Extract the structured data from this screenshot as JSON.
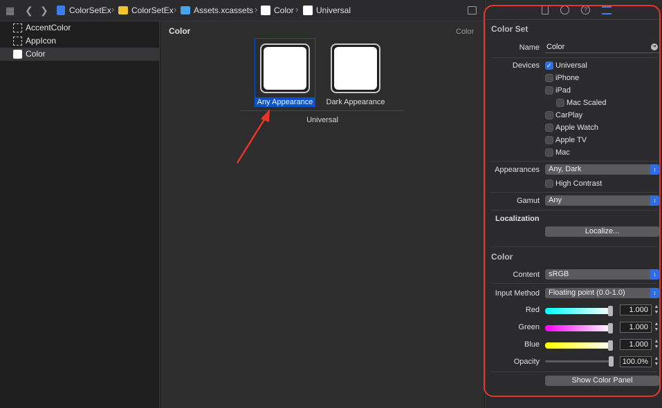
{
  "breadcrumb": {
    "items": [
      "ColorSetEx",
      "ColorSetEx",
      "Assets.xcassets",
      "Color",
      "Universal"
    ]
  },
  "navigator": {
    "items": [
      {
        "label": "AccentColor",
        "selected": false
      },
      {
        "label": "AppIcon",
        "selected": false
      },
      {
        "label": "Color",
        "selected": true
      }
    ]
  },
  "editor": {
    "title": "Color",
    "right_label": "Color",
    "wells": [
      {
        "label": "Any Appearance",
        "selected": true
      },
      {
        "label": "Dark Appearance",
        "selected": false
      }
    ],
    "group_label": "Universal"
  },
  "inspector": {
    "tab_icons": [
      "file-icon",
      "history-icon",
      "help-icon",
      "attributes-icon"
    ],
    "color_set_title": "Color Set",
    "name_label": "Name",
    "name_value": "Color",
    "devices_label": "Devices",
    "devices": [
      {
        "label": "Universal",
        "checked": true
      },
      {
        "label": "iPhone",
        "checked": false
      },
      {
        "label": "iPad",
        "checked": false
      },
      {
        "label": "Mac Scaled",
        "checked": false
      },
      {
        "label": "CarPlay",
        "checked": false
      },
      {
        "label": "Apple Watch",
        "checked": false
      },
      {
        "label": "Apple TV",
        "checked": false
      },
      {
        "label": "Mac",
        "checked": false
      }
    ],
    "appearances_label": "Appearances",
    "appearances_value": "Any, Dark",
    "high_contrast_label": "High Contrast",
    "gamut_label": "Gamut",
    "gamut_value": "Any",
    "localization_label": "Localization",
    "localize_button": "Localize...",
    "color_title": "Color",
    "content_label": "Content",
    "content_value": "sRGB",
    "input_method_label": "Input Method",
    "input_method_value": "Floating point (0.0-1.0)",
    "red_label": "Red",
    "red_value": "1.000",
    "green_label": "Green",
    "green_value": "1.000",
    "blue_label": "Blue",
    "blue_value": "1.000",
    "opacity_label": "Opacity",
    "opacity_value": "100.0%",
    "show_color_panel": "Show Color Panel"
  },
  "colors": {
    "annotation": "#e8352a",
    "accent": "#2f6ee0",
    "selection": "#0b53cc"
  }
}
